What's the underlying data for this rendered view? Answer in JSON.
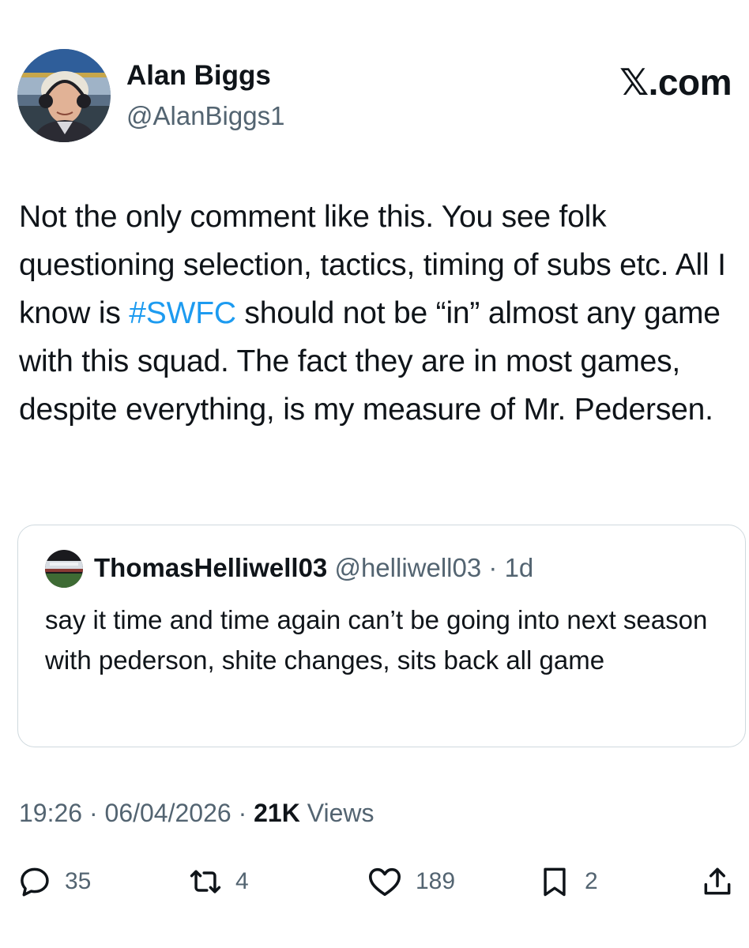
{
  "author": {
    "name": "Alan Biggs",
    "handle": "@AlanBiggs1"
  },
  "brand": "𝕏.com",
  "tweet": {
    "text_before": "Not the only comment like this. You see folk questioning selection, tactics, timing of subs etc. All I know is ",
    "hashtag": "#SWFC",
    "text_after": " should not be “in” almost any game with this squad. The fact they are in most games, despite everything, is my measure of Mr. Pedersen."
  },
  "quote": {
    "name": "ThomasHelliwell03",
    "handle": "@helliwell03",
    "separator": "·",
    "time": "1d",
    "text": "say it time and time again can’t be going into next season with pederson, shite changes, sits back all game"
  },
  "meta": {
    "time": "19:26",
    "separator": "·",
    "date": "06/04/2026",
    "views_count": "21K",
    "views_label": "Views"
  },
  "actions": {
    "replies": "35",
    "reposts": "4",
    "likes": "189",
    "bookmarks": "2"
  },
  "colors": {
    "text": "#0f1419",
    "secondary": "#536471",
    "link": "#1d9bf0",
    "border": "#cfd9de"
  },
  "icons": {
    "reply": "reply-icon",
    "repost": "repost-icon",
    "like": "heart-icon",
    "bookmark": "bookmark-icon",
    "share": "share-icon"
  }
}
